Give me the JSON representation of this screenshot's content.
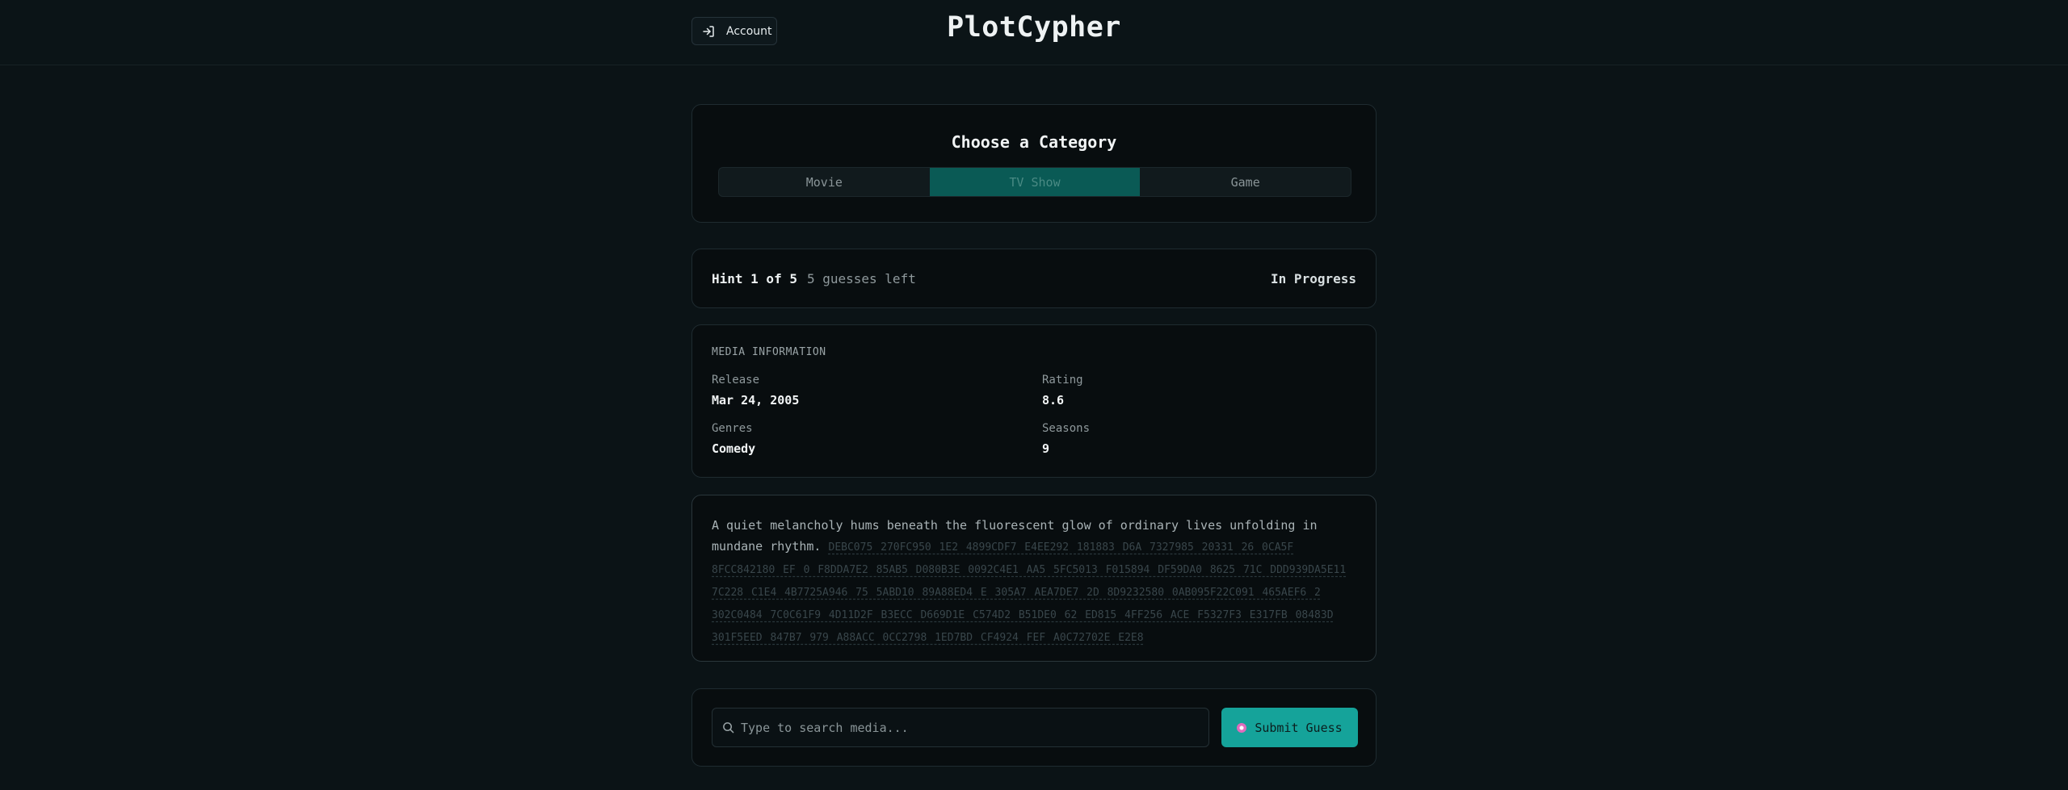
{
  "header": {
    "account_label": "Account",
    "brand": "PlotCypher"
  },
  "category": {
    "title": "Choose a Category",
    "tabs": [
      {
        "label": "Movie"
      },
      {
        "label": "TV Show",
        "active": true
      },
      {
        "label": "Game"
      }
    ],
    "active_color": "#0a5a55"
  },
  "hint": {
    "label": "Hint 1 of 5",
    "guesses_left": "5 guesses left",
    "status": "In Progress"
  },
  "media_info": {
    "title": "MEDIA INFORMATION",
    "release_label": "Release",
    "release_value": "Mar 24, 2005",
    "rating_label": "Rating",
    "rating_value": "8.6",
    "genres_label": "Genres",
    "genres_value": "Comedy",
    "seasons_label": "Seasons",
    "seasons_value": "9"
  },
  "plot": {
    "revealed": "A quiet melancholy hums beneath the fluorescent glow of ordinary lives unfolding in mundane rhythm.",
    "hidden": "DEBC075 270FC950 1E2 4899CDF7 E4EE292 181883 D6A 7327985 20331 26 0CA5F 8FCC842180 EF 0 F8DDA7E2 85AB5 D080B3E 0092C4E1 AA5 5FC5013 F015894 DF59DA0 8625 71C DDD939DA5E11 7C228 C1E4 4B7725A946 75 5ABD10 89A88ED4 E 305A7 AEA7DE7 2D 8D9232580 0AB095F22C091 465AEF6 2 302C0484 7C0C61F9 4D11D2F B3ECC D669D1E C574D2 B51DE0 62 ED815 4FF256 ACE F5327F3 E317FB 08483D 301F5EED 847B7 979 A88ACC 0CC2798 1ED7BD CF4924 FEF A0C72702E E2E8"
  },
  "guess": {
    "search_placeholder": "Type to search media...",
    "submit_label": "Submit Guess",
    "accent": "#15a39a"
  }
}
